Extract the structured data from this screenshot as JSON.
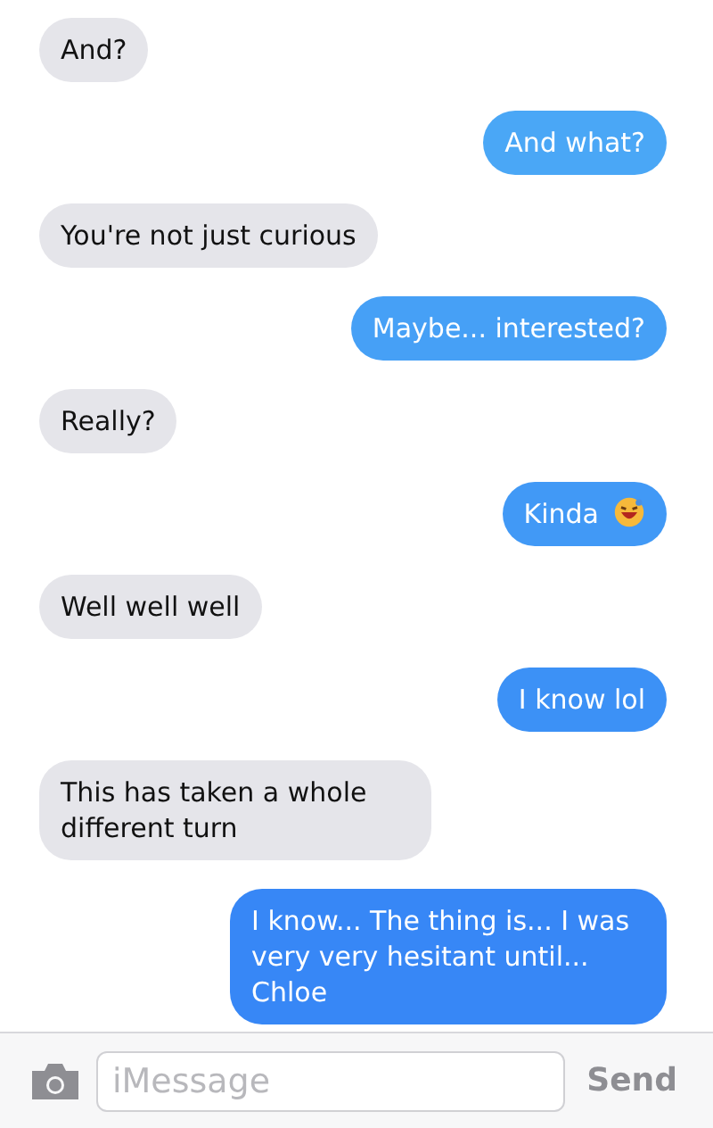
{
  "messages": [
    {
      "kind": "received",
      "text": "And?"
    },
    {
      "kind": "sent",
      "text": "And what?"
    },
    {
      "kind": "received",
      "text": "You're not just curious"
    },
    {
      "kind": "sent",
      "text": "Maybe... interested?"
    },
    {
      "kind": "received",
      "text": "Really?"
    },
    {
      "kind": "sent",
      "text": "Kinda",
      "emoji": true
    },
    {
      "kind": "received",
      "text": "Well well well"
    },
    {
      "kind": "sent",
      "text": "I know lol"
    },
    {
      "kind": "received",
      "text": "This has taken a whole different turn"
    },
    {
      "kind": "sent",
      "text": "I know... The thing is... I was very very hesitant until... Chloe"
    }
  ],
  "composer": {
    "placeholder": "iMessage",
    "send": "Send"
  }
}
